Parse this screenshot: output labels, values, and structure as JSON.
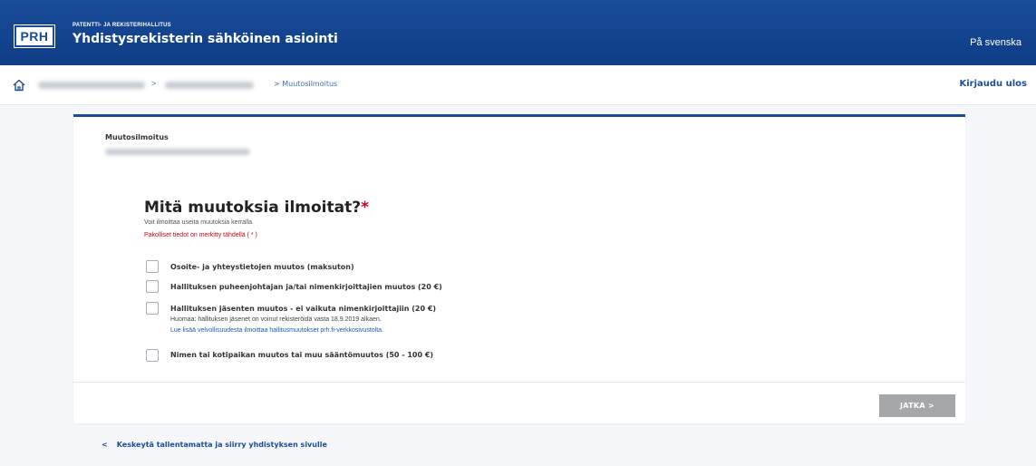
{
  "header": {
    "logo_text": "PRH",
    "org_name": "PATENTTI- JA REKISTERIHALLITUS",
    "app_title": "Yhdistysrekisterin sähköinen asiointi",
    "language_link": "På svenska"
  },
  "breadcrumb": {
    "separator": ">",
    "current": "> Muutosilmoitus"
  },
  "nav": {
    "logout": "Kirjaudu ulos"
  },
  "card": {
    "title": "Muutosilmoitus",
    "question": "Mitä muutoksia ilmoitat?",
    "required_mark": "*",
    "hint": "Voit ilmoittaa useita muutoksia kerralla.",
    "required_note": "Pakolliset tiedot on merkitty tähdellä ( * )",
    "options": [
      {
        "label": "Osoite- ja yhteystietojen muutos (maksuton)"
      },
      {
        "label": "Hallituksen puheenjohtajan ja/tai nimenkirjoittajien muutos (20 €)"
      },
      {
        "label": "Hallituksen jäsenten muutos - ei vaikuta nimenkirjoittajiin (20 €)",
        "note": "Huomaa: hallituksen jäsenet on voinut rekisteröidä vasta 18.9.2019 alkaen.",
        "link": "Lue lisää velvollisuudesta ilmoittaa hallitusmuutokset prh.fi-verkkosivustolta."
      },
      {
        "label": "Nimen tai kotipaikan muutos tai muu sääntömuutos (50 - 100 €)"
      }
    ],
    "next_button": "JATKA >"
  },
  "footer": {
    "cancel_chevron": "<",
    "cancel_link": "Keskeytä tallentamatta ja siirry yhdistyksen sivulle"
  }
}
